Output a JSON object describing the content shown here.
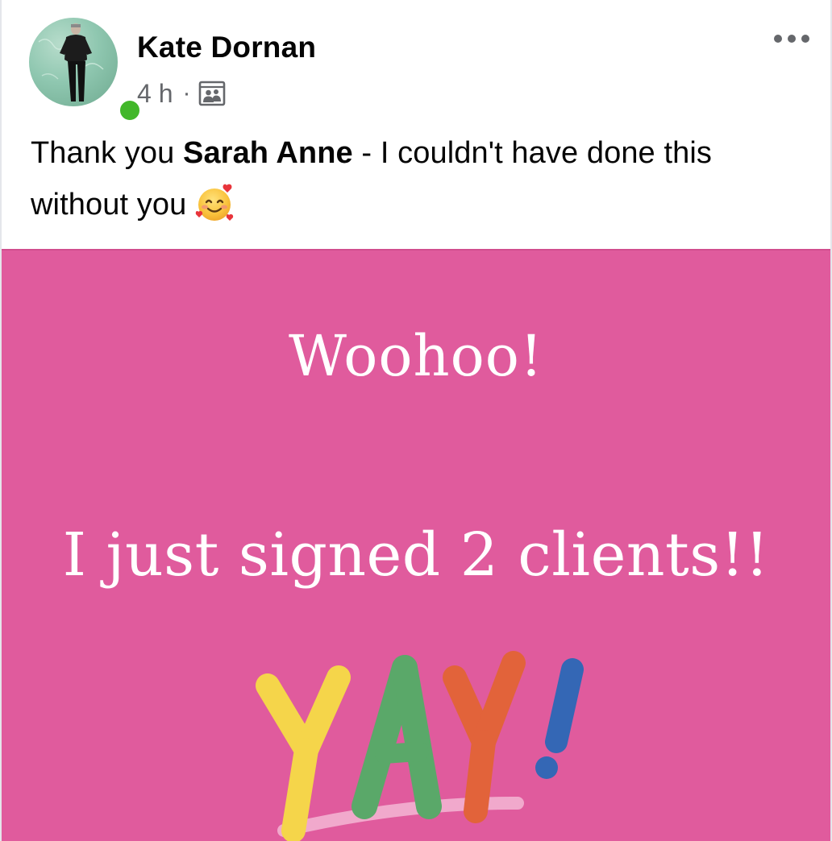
{
  "post": {
    "author_name": "Kate Dornan",
    "time": "4 h",
    "separator": "·",
    "audience_icon": "group-audience-icon",
    "more_icon": "more-options-icon",
    "text_before": "Thank you ",
    "mention": "Sarah Anne",
    "text_middle": " - I couldn't have done this without you",
    "emoji": "smiling-face-with-hearts-icon"
  },
  "media": {
    "line1": "Woohoo!",
    "line2": "I just signed 2 clients!!",
    "art_text": "YAY!",
    "background_color": "#e05b9d",
    "letter_colors": [
      "#f5d54a",
      "#5aa869",
      "#e2633a",
      "#3467b5"
    ]
  },
  "colors": {
    "online_dot": "#42b72a",
    "name_text": "#050505",
    "meta_text": "#65676b"
  }
}
